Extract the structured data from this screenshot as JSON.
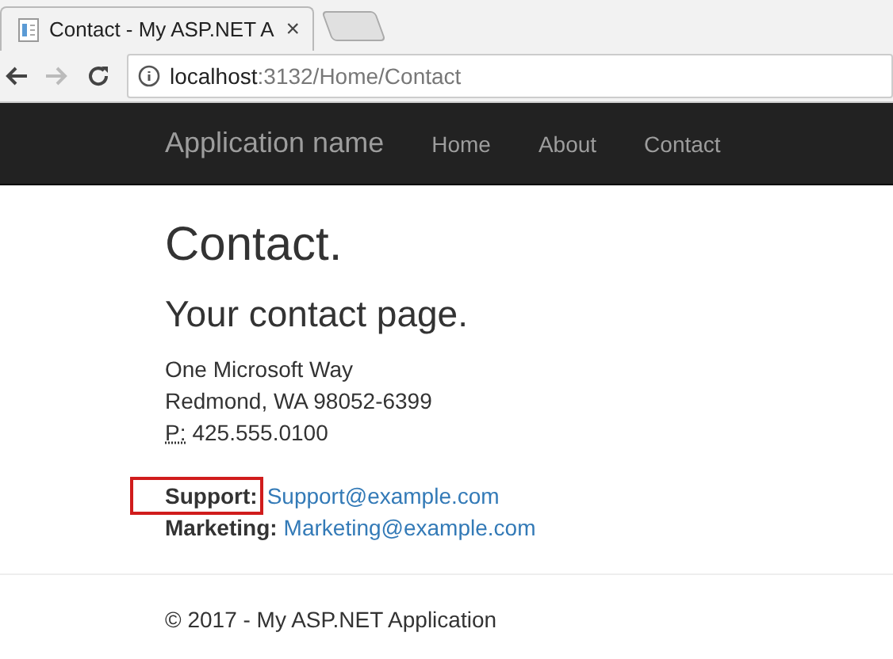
{
  "browser": {
    "tab": {
      "title": "Contact - My ASP.NET A",
      "close": "×"
    },
    "address": {
      "host": "localhost",
      "path": ":3132/Home/Contact"
    }
  },
  "navbar": {
    "brand": "Application name",
    "links": [
      {
        "label": "Home"
      },
      {
        "label": "About"
      },
      {
        "label": "Contact"
      }
    ]
  },
  "page": {
    "title": "Contact.",
    "subtitle": "Your contact page.",
    "address_lines": [
      "One Microsoft Way",
      "Redmond, WA 98052-6399"
    ],
    "phone_abbr": "P:",
    "phone": "425.555.0100",
    "contacts": [
      {
        "label": "Support:",
        "email": "Support@example.com",
        "highlighted": true
      },
      {
        "label": "Marketing:",
        "email": "Marketing@example.com",
        "highlighted": false
      }
    ]
  },
  "footer": "© 2017 - My ASP.NET Application"
}
